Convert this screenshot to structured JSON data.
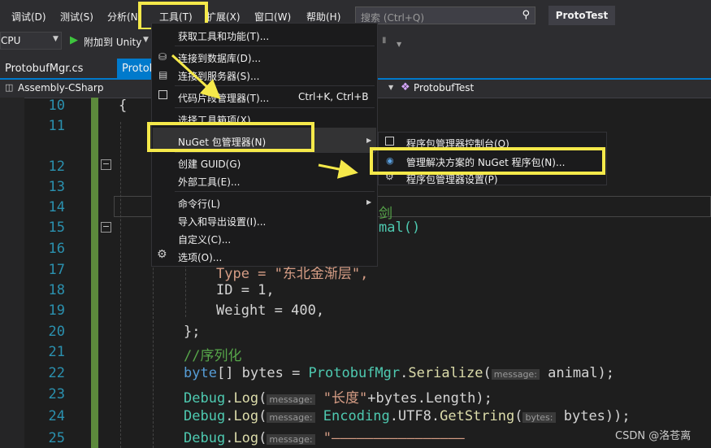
{
  "menubar": {
    "items": [
      "调试(D)",
      "测试(S)",
      "分析(N)",
      "工具(T)",
      "扩展(X)",
      "窗口(W)",
      "帮助(H)"
    ],
    "search_placeholder": "搜索 (Ctrl+Q)",
    "project_title": "ProtoTest"
  },
  "toolbar": {
    "platform": "CPU",
    "attach_label": "附加到 Unity"
  },
  "tabs": [
    "ProtobufMgr.cs",
    "Protob"
  ],
  "navbar": {
    "left": "Assembly-CSharp",
    "right": "ProtobufTest"
  },
  "line_numbers": [
    "10",
    "11",
    "12",
    "13",
    "14",
    "15",
    "16",
    "17",
    "18",
    "19",
    "20",
    "21",
    "22",
    "23",
    "24",
    "25"
  ],
  "code": {
    "l10": "{",
    "l15_tail": "mal()",
    "l17": "Type = \"东北金渐层\",",
    "l18": "ID = 1,",
    "l19": "Weight = 400,",
    "l20": "};",
    "l21": "//序列化",
    "l22_a": "byte",
    "l22_b": "[] bytes = ",
    "l22_c": "ProtobufMgr",
    "l22_d": ".",
    "l22_e": "Serialize",
    "l22_f": "(",
    "l22_hint": "message:",
    "l22_g": " animal);",
    "l23_a": "Debug",
    "l23_b": ".",
    "l23_c": "Log",
    "l23_d": "(",
    "l23_hint": "message:",
    "l23_e": " \"长度\"",
    "l23_f": "+bytes.Length);",
    "l24_a": "Debug",
    "l24_c": "Log",
    "l24_hint": "message:",
    "l24_e": " Encoding",
    "l24_f": ".UTF8.",
    "l24_g": "GetString",
    "l24_h": "(",
    "l24_hint2": "bytes:",
    "l24_i": " bytes));",
    "l25_a": "Debug",
    "l25_c": "Log",
    "l25_hint": "message:",
    "l25_e": " \"————————————————",
    "l14_comment": "剑"
  },
  "tools_menu": {
    "items": [
      {
        "label": "获取工具和功能(T)...",
        "shortcut": ""
      },
      {
        "label": "连接到数据库(D)...",
        "shortcut": ""
      },
      {
        "label": "连接到服务器(S)...",
        "shortcut": ""
      },
      {
        "label": "代码片段管理器(T)...",
        "shortcut": "Ctrl+K, Ctrl+B"
      },
      {
        "label": "选择工具箱项(X)...",
        "shortcut": ""
      },
      {
        "label": "NuGet 包管理器(N)",
        "shortcut": ""
      },
      {
        "label": "创建 GUID(G)",
        "shortcut": ""
      },
      {
        "label": "外部工具(E)...",
        "shortcut": ""
      },
      {
        "label": "命令行(L)",
        "shortcut": ""
      },
      {
        "label": "导入和导出设置(I)...",
        "shortcut": ""
      },
      {
        "label": "自定义(C)...",
        "shortcut": ""
      },
      {
        "label": "选项(O)...",
        "shortcut": ""
      }
    ]
  },
  "nuget_submenu": {
    "items": [
      "程序包管理器控制台(O)",
      "管理解决方案的 NuGet 程序包(N)...",
      "程序包管理器设置(P)"
    ]
  },
  "watermark": "CSDN @洛苍离",
  "colors": {
    "highlight": "#f5e94a",
    "accent": "#007acc",
    "keyword": "#569cd6",
    "type": "#4ec9b0",
    "method": "#dcdcaa",
    "string": "#d69d85",
    "comment": "#57a64a"
  }
}
